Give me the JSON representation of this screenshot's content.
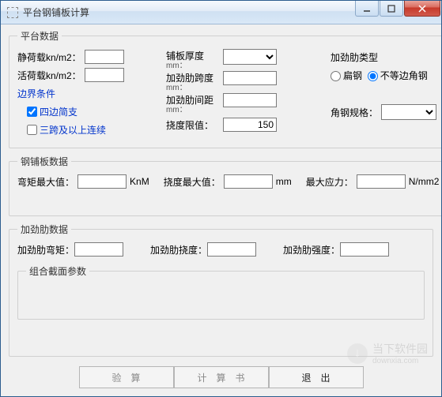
{
  "title": "平台钢铺板计算",
  "groups": {
    "platform": {
      "legend": "平台数据",
      "static_load_label": "静荷载kn/m2：",
      "live_load_label": "活荷载kn/m2：",
      "boundary_label": "边界条件",
      "cb_simple": "四边简支",
      "cb_continuous": "三跨及以上连续",
      "cb_simple_checked": true,
      "cb_continuous_checked": false,
      "plate_thick_label": "铺板厚度",
      "plate_thick_unit": "mm：",
      "rib_span_label": "加劲肋跨度",
      "rib_span_unit": "mm：",
      "rib_spacing_label": "加劲肋间距",
      "rib_spacing_unit": "mm：",
      "deflect_limit_label": "挠度限值：",
      "deflect_limit_value": "150",
      "rib_type_label": "加劲肋类型",
      "radio_flat": "扁钢",
      "radio_angle": "不等边角钢",
      "angle_spec_label": "角钢规格："
    },
    "plate": {
      "legend": "钢铺板数据",
      "moment_label": "弯矩最大值：",
      "moment_unit": "KnM",
      "deflect_label": "挠度最大值：",
      "deflect_unit": "mm",
      "stress_label": "最大应力：",
      "stress_unit": "N/mm2"
    },
    "rib": {
      "legend": "加劲肋数据",
      "moment_label": "加劲肋弯矩：",
      "deflect_label": "加劲肋挠度：",
      "strength_label": "加劲肋强度：",
      "section_legend": "组合截面参数"
    }
  },
  "buttons": {
    "calc": "验算",
    "report": "计算书",
    "exit": "退出"
  },
  "watermark": {
    "brand": "当下软件园",
    "url": "downxia.com"
  }
}
